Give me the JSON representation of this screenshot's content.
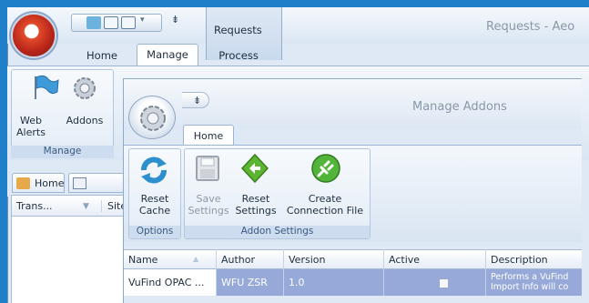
{
  "outer": {
    "window_title": "Requests - Aeo",
    "context_tab": "Requests",
    "tabs": [
      "Home",
      "Manage",
      "Process"
    ],
    "active_tab": "Manage",
    "ribbon": {
      "buttons": [
        {
          "label": "Web\nAlerts",
          "icon": "flag-icon"
        },
        {
          "label": "Addons",
          "icon": "gear-icon"
        }
      ],
      "group_label": "Manage"
    },
    "doc_tabs": [
      "Home",
      ""
    ],
    "grid_columns": [
      "Trans...",
      "Site"
    ]
  },
  "inner": {
    "window_title": "Manage Addons",
    "tab": "Home",
    "groups": [
      {
        "label": "Options",
        "buttons": [
          {
            "label": "Reset\nCache",
            "icon": "refresh-icon",
            "enabled": true
          }
        ]
      },
      {
        "label": "Addon Settings",
        "buttons": [
          {
            "label": "Save\nSettings",
            "icon": "save-icon",
            "enabled": false
          },
          {
            "label": "Reset\nSettings",
            "icon": "reset-settings-icon",
            "enabled": true
          },
          {
            "label": "Create\nConnection File",
            "icon": "plug-icon",
            "enabled": true
          }
        ]
      }
    ],
    "grid": {
      "columns": [
        "Name",
        "Author",
        "Version",
        "Active",
        "Description"
      ],
      "rows": [
        {
          "name": "VuFind OPAC ...",
          "author": "WFU ZSR",
          "version": "1.0",
          "active": false,
          "description": "Performs a VuFind\nImport Info will co"
        }
      ]
    }
  },
  "colors": {
    "accent": "#1f7fc8",
    "selection": "#96a9d9"
  }
}
